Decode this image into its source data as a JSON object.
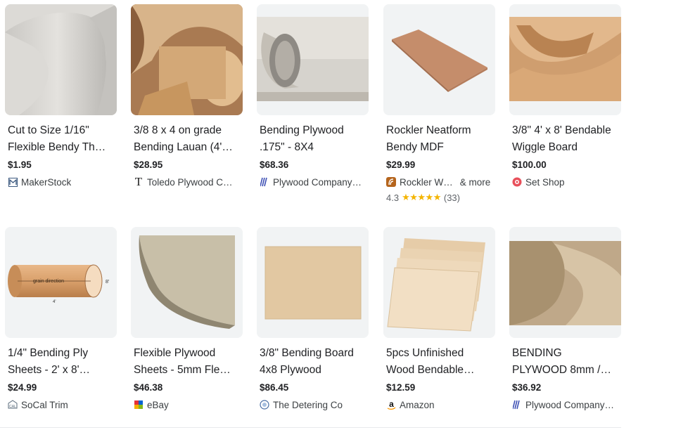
{
  "products": [
    {
      "title_1": "Cut to Size 1/16\"",
      "title_2": "Flexible Bendy Th…",
      "price": "$1.95",
      "seller": "MakerStock",
      "icon": "makerstock-icon"
    },
    {
      "title_1": "3/8 8 x 4 on grade",
      "title_2": "Bending Lauan (4'…",
      "price": "$28.95",
      "seller": "Toledo Plywood C…",
      "icon": "toledo-t-icon"
    },
    {
      "title_1": "Bending Plywood",
      "title_2": ".175\" - 8X4",
      "price": "$68.36",
      "seller": "Plywood Company…",
      "icon": "plywood-company-icon"
    },
    {
      "title_1": "Rockler Neatform",
      "title_2": "Bendy MDF",
      "price": "$29.99",
      "seller": "Rockler W…",
      "more": "& more",
      "rating": "4.3",
      "stars": "★★★★★",
      "reviews": "(33)",
      "icon": "rockler-icon"
    },
    {
      "title_1": "3/8\" 4' x 8' Bendable",
      "title_2": "Wiggle Board",
      "price": "$100.00",
      "seller": "Set Shop",
      "icon": "set-shop-icon"
    },
    {
      "title_1": "1/4\" Bending Ply",
      "title_2": "Sheets - 2' x 8'…",
      "price": "$24.99",
      "seller": "SoCal Trim",
      "icon": "socal-trim-icon"
    },
    {
      "title_1": "Flexible Plywood",
      "title_2": "Sheets - 5mm Fle…",
      "price": "$46.38",
      "seller": "eBay",
      "icon": "ebay-icon"
    },
    {
      "title_1": "3/8\" Bending Board",
      "title_2": "4x8 Plywood",
      "price": "$86.45",
      "seller": "The Detering Co",
      "icon": "detering-icon"
    },
    {
      "title_1": "5pcs Unfinished",
      "title_2": "Wood Bendable…",
      "price": "$12.59",
      "seller": "Amazon",
      "icon": "amazon-icon"
    },
    {
      "title_1": "BENDING",
      "title_2": "PLYWOOD 8mm /…",
      "price": "$36.92",
      "seller": "Plywood Company…",
      "icon": "plywood-company-icon"
    }
  ],
  "image_labels": {
    "grain_direction": "grain direction",
    "dim_8": "8'",
    "dim_4": "4'"
  },
  "colors": {
    "thumb_bg": "#f1f3f4",
    "star": "#f4b400",
    "plywood_blue": "#3f51b5"
  }
}
